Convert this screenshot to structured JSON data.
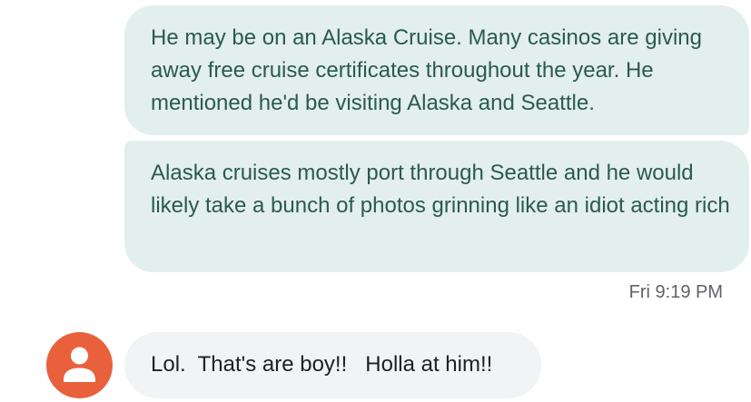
{
  "messages": [
    {
      "direction": "sent",
      "text": "He may be on an Alaska Cruise. Many casinos are giving away free cruise certificates throughout the year. He mentioned he'd be visiting Alaska and Seattle."
    },
    {
      "direction": "sent",
      "text": "Alaska cruises mostly port through Seattle and he would likely take a bunch of photos grinning like an idiot acting rich"
    },
    {
      "direction": "received",
      "text": "Lol.  That's are boy!!   Holla at him!!"
    }
  ],
  "timestamp": "Fri 9:19 PM",
  "contact": {
    "avatar_icon": "person-icon",
    "avatar_color": "#e8613c"
  },
  "colors": {
    "sent_bubble": "#e2efed",
    "sent_text": "#2b5a4e",
    "received_bubble": "#f1f3f4",
    "received_text": "#202124",
    "timestamp_text": "#5f6368"
  }
}
